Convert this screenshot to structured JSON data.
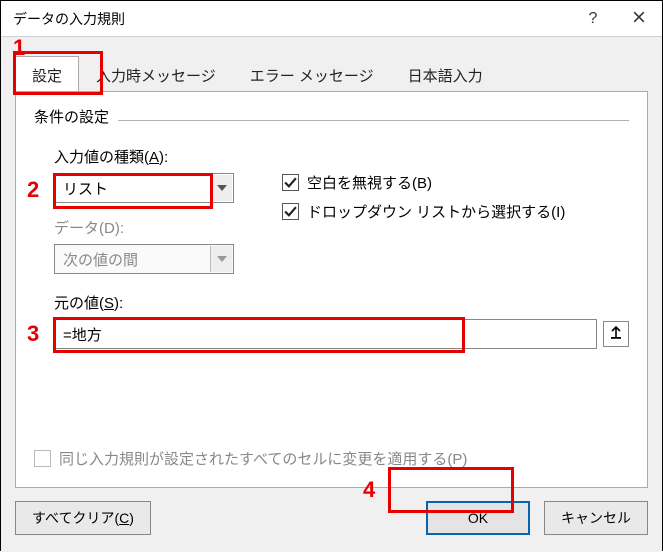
{
  "window": {
    "title": "データの入力規則",
    "help_tooltip": "?",
    "close_tooltip": "×"
  },
  "tabs": {
    "settings": "設定",
    "input_message": "入力時メッセージ",
    "error_alert": "エラー メッセージ",
    "ime": "日本語入力"
  },
  "group": {
    "criteria_title": "条件の設定"
  },
  "allow": {
    "label_pre": "入力値の種類(",
    "label_key": "A",
    "label_post": "):",
    "value": "リスト"
  },
  "data": {
    "label": "データ(D):",
    "value": "次の値の間"
  },
  "ignore_blank": {
    "label_pre": "空白を無視する(",
    "label_key": "B",
    "label_post": ")"
  },
  "dropdown": {
    "label_pre": "ドロップダウン リストから選択する(",
    "label_key": "I",
    "label_post": ")"
  },
  "source": {
    "label_pre": "元の値(",
    "label_key": "S",
    "label_post": "):",
    "value": "=地方"
  },
  "apply_same": {
    "label": "同じ入力規則が設定されたすべてのセルに変更を適用する(P)"
  },
  "buttons": {
    "clear_all_pre": "すべてクリア(",
    "clear_all_key": "C",
    "clear_all_post": ")",
    "ok": "OK",
    "cancel": "キャンセル"
  },
  "annotations": {
    "n1": "1",
    "n2": "2",
    "n3": "3",
    "n4": "4"
  }
}
